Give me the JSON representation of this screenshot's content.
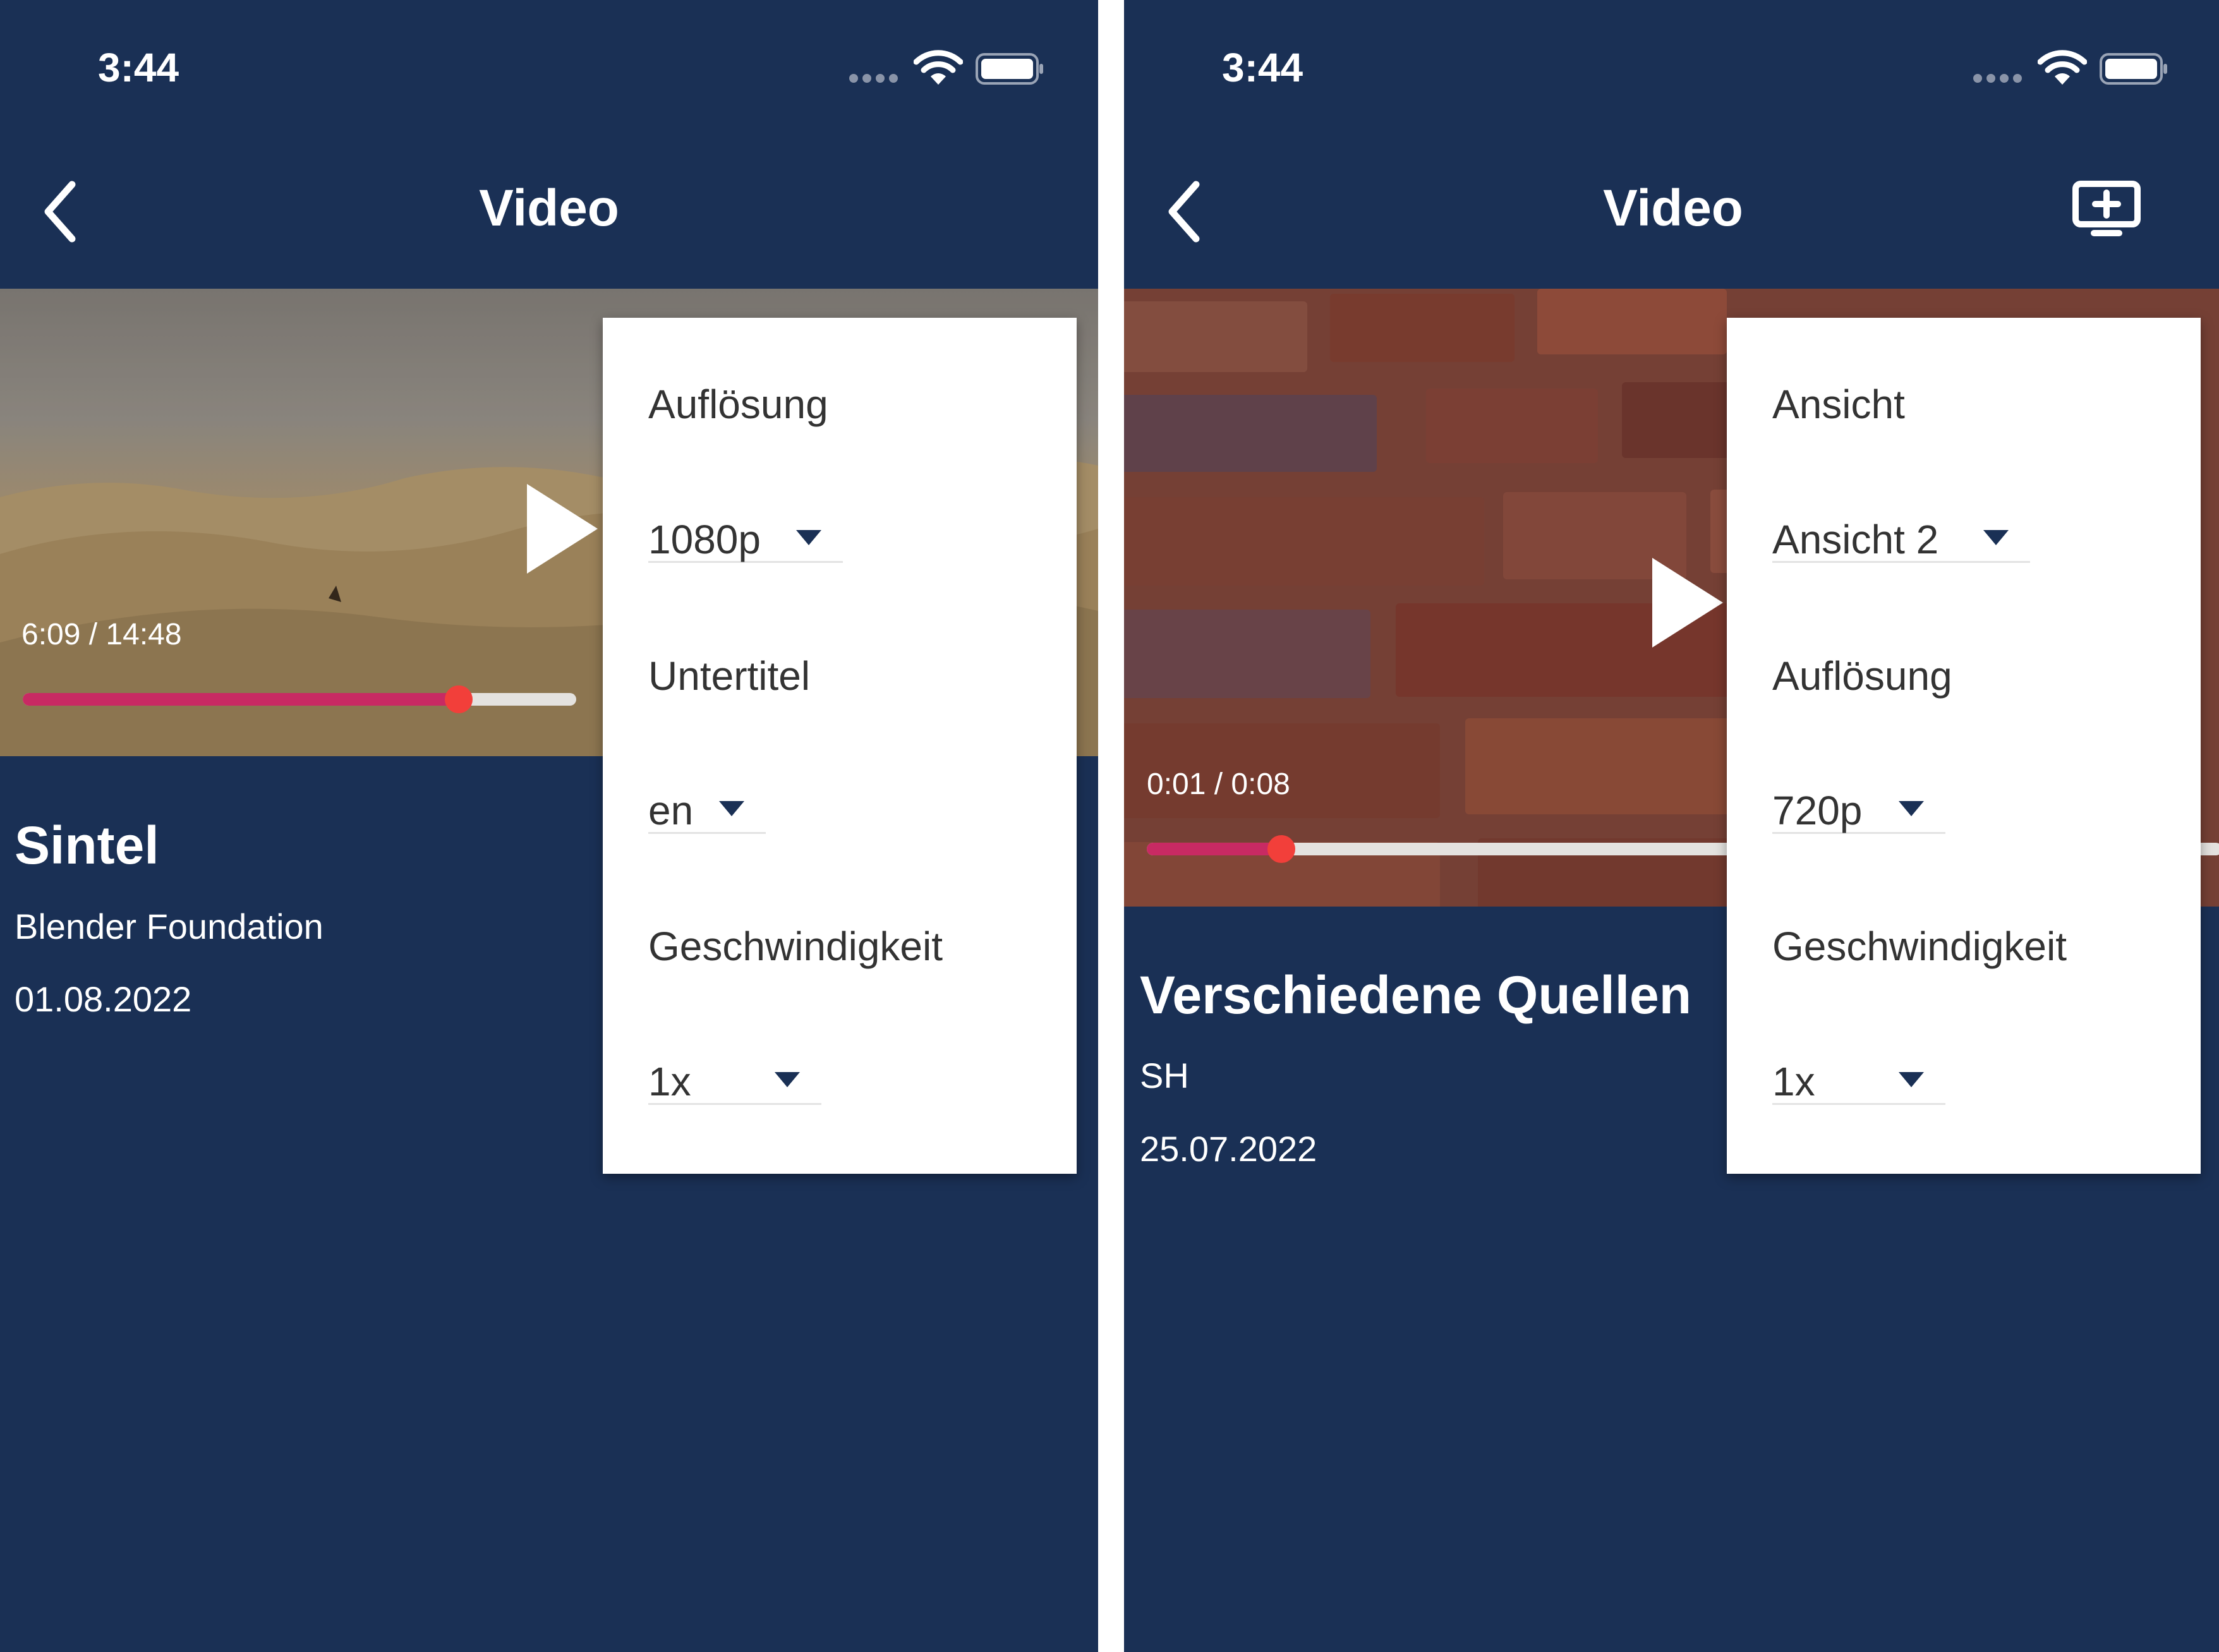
{
  "left": {
    "status_bar": {
      "time": "3:44"
    },
    "header": {
      "title": "Video"
    },
    "player": {
      "time": "6:09 / 14:48",
      "progress": 0.7875
    },
    "info": {
      "title": "Sintel",
      "author": "Blender Foundation",
      "date": "01.08.2022"
    },
    "settings": {
      "resolution_label": "Auflösung",
      "resolution_value": "1080p",
      "subtitle_label": "Untertitel",
      "subtitle_value": "en",
      "speed_label": "Geschwindigkeit",
      "speed_value": "1x"
    }
  },
  "right": {
    "status_bar": {
      "time": "3:44"
    },
    "header": {
      "title": "Video"
    },
    "player": {
      "time": "0:01 / 0:08",
      "progress": 0.125
    },
    "info": {
      "title": "Verschiedene Quellen",
      "author": "SH",
      "date": "25.07.2022"
    },
    "settings": {
      "view_label": "Ansicht",
      "view_value": "Ansicht 2",
      "resolution_label": "Auflösung",
      "resolution_value": "720p",
      "speed_label": "Geschwindigkeit",
      "speed_value": "1x"
    }
  },
  "colors": {
    "background": "#1a3055",
    "progress": "#c82a63",
    "progress_knob": "#f23f3a",
    "menu": "#ffffff"
  },
  "icons": [
    "back-icon",
    "wifi-icon",
    "battery-icon",
    "signal-icon",
    "screen-add-icon",
    "play-icon",
    "caret-down-icon"
  ]
}
